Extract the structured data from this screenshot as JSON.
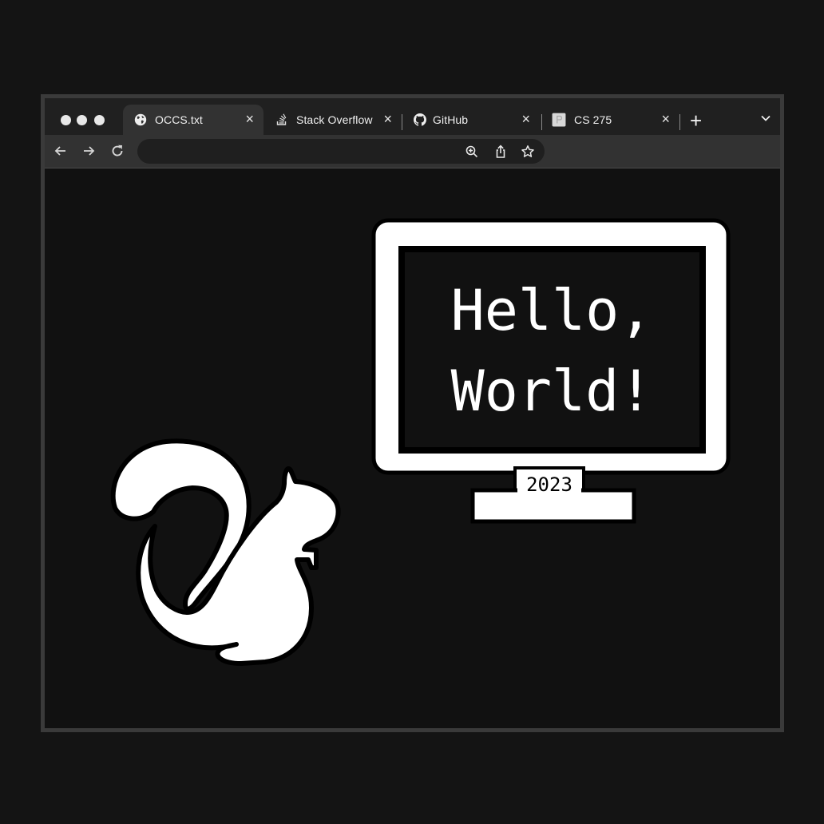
{
  "window": {
    "tabs": [
      {
        "label": "OCCS.txt",
        "icon": "globe-icon",
        "active": true
      },
      {
        "label": "Stack Overflow",
        "icon": "stack-overflow-icon",
        "active": false
      },
      {
        "label": "GitHub",
        "icon": "github-icon",
        "active": false
      },
      {
        "label": "CS 275",
        "icon": "page-icon",
        "active": false
      }
    ],
    "close_glyph": "×",
    "new_tab_glyph": "+"
  },
  "illustration": {
    "screen_line1": "Hello,",
    "screen_line2": "World!",
    "year": "2023"
  },
  "colors": {
    "background": "#141414",
    "tabstrip": "#202020",
    "active_tab": "#323232",
    "illustration": "#ffffff"
  }
}
